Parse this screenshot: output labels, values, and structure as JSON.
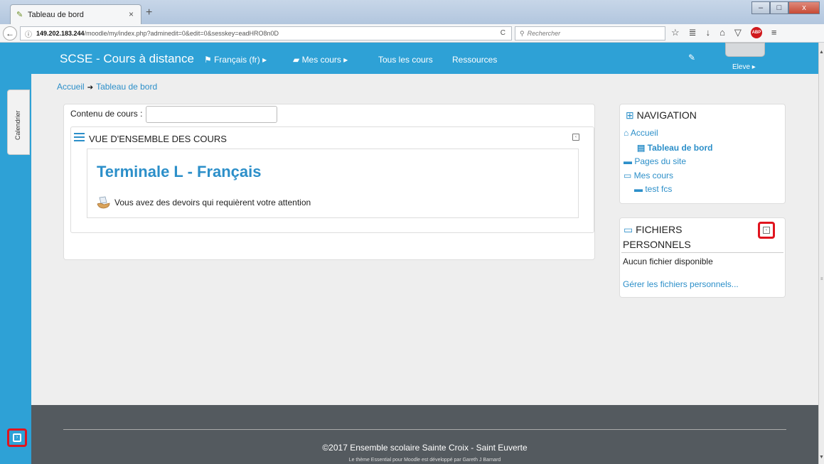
{
  "browser": {
    "tab_title": "Tableau de bord",
    "tab_close": "×",
    "new_tab": "+",
    "url_host": "149.202.183.244",
    "url_rest": "/moodle/my/index.php?adminedit=0&edit=0&sesskey=eadHRO8n0D",
    "search_placeholder": "Rechercher",
    "window_close": "x"
  },
  "header": {
    "site_title": "SCSE - Cours à distance",
    "language": "Français (fr) ▸",
    "my_courses": "Mes cours ▸",
    "all_courses": "Tous les cours",
    "resources": "Ressources",
    "user": "Eleve ▸"
  },
  "sidebar": {
    "calendar_tab": "Calendrier"
  },
  "breadcrumb": {
    "home": "Accueil",
    "current": "Tableau de bord"
  },
  "main": {
    "course_content_label": "Contenu de cours :",
    "course_content_value": "",
    "overview_title": "VUE D'ENSEMBLE DES COURS",
    "course_name": "Terminale L - Français",
    "assignment_notice": "Vous avez des devoirs qui requièrent votre attention"
  },
  "navigation_block": {
    "title": "NAVIGATION",
    "items": [
      {
        "label": "Accueil"
      },
      {
        "label": "Tableau de bord"
      },
      {
        "label": "Pages du site"
      },
      {
        "label": "Mes cours"
      },
      {
        "label": "test fcs"
      }
    ]
  },
  "files_block": {
    "title_line1": "FICHIERS",
    "title_line2": "PERSONNELS",
    "empty_text": "Aucun fichier disponible",
    "manage_link": "Gérer les fichiers personnels..."
  },
  "footer": {
    "copyright": "©2017 Ensemble scolaire Sainte Croix - Saint Euverte",
    "theme_credit": "Le thème Essential pour Moodle est développé par Gareth J Barnard"
  },
  "colors": {
    "brand": "#2ea1d6",
    "link": "#2c8fc9",
    "footer": "#545a5f",
    "highlight": "#e0141e"
  }
}
